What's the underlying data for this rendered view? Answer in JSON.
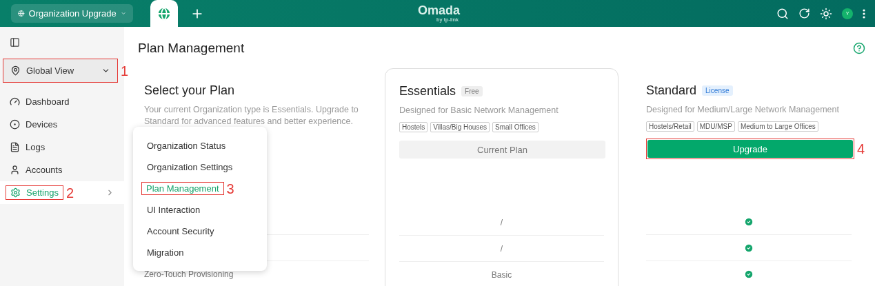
{
  "header": {
    "org_selector": "Organization Upgrade",
    "logo": "Omada",
    "logo_sub": "by tp-link",
    "avatar": "Y"
  },
  "sidebar": {
    "site_selector": {
      "label": "Global View",
      "callout": "1"
    },
    "items": [
      {
        "label": "Dashboard",
        "selected": false
      },
      {
        "label": "Devices",
        "selected": false
      },
      {
        "label": "Logs",
        "selected": false
      },
      {
        "label": "Accounts",
        "selected": false
      },
      {
        "label": "Settings",
        "selected": true,
        "has_submenu": true,
        "callout": "2"
      }
    ]
  },
  "page": {
    "title": "Plan Management"
  },
  "intro": {
    "title": "Select your Plan",
    "description": "Your current Organization type is Essentials. Upgrade to Standard for advanced features and better experience."
  },
  "plans": [
    {
      "name": "Essentials",
      "badge": "Free",
      "kind": "current",
      "tagline": "Designed for Basic Network Management",
      "tags": [
        "Hostels",
        "Villas/Big Houses",
        "Small Offices"
      ],
      "action": "Current Plan"
    },
    {
      "name": "Standard",
      "badge": "License",
      "kind": "upgrade",
      "tagline": "Designed for Medium/Large Network Management",
      "tags": [
        "Hostels/Retail",
        "MDU/MSP",
        "Medium to Large Offices"
      ],
      "action": "Upgrade",
      "action_callout": "4"
    }
  ],
  "features": [
    {
      "essentials": "/",
      "standard_included": true
    },
    {
      "essentials": "/",
      "standard_included": true
    },
    {
      "name": "Zero-Touch Provisioning",
      "essentials": "Basic",
      "standard_included": true
    }
  ],
  "settings_menu": {
    "items": [
      {
        "label": "Organization Status",
        "selected": false
      },
      {
        "label": "Organization Settings",
        "selected": false
      },
      {
        "label": "Plan Management",
        "selected": true,
        "callout": "3"
      },
      {
        "label": "UI Interaction",
        "selected": false
      },
      {
        "label": "Account Security",
        "selected": false
      },
      {
        "label": "Migration",
        "selected": false
      }
    ]
  }
}
